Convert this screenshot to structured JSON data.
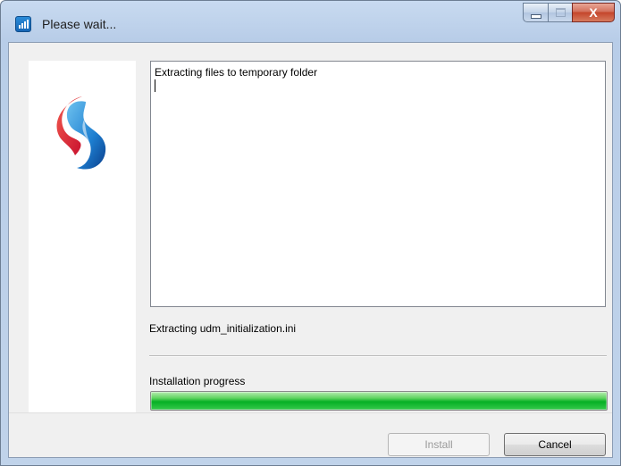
{
  "window": {
    "title": "Please wait...",
    "close_glyph": "X"
  },
  "log": {
    "lines": [
      "Extracting files to temporary folder"
    ]
  },
  "status": {
    "current_action": "Extracting udm_initialization.ini"
  },
  "progress": {
    "label": "Installation progress",
    "fraction": 1.0,
    "color": "#06b025"
  },
  "buttons": {
    "install_label": "Install",
    "cancel_label": "Cancel"
  },
  "icons": {
    "app_icon": "signal-bars-icon",
    "logo": "swisscom-logo"
  },
  "colors": {
    "titlebar": "#b8cde8",
    "close_button": "#c4452b",
    "client_background": "#f0f0f0"
  }
}
